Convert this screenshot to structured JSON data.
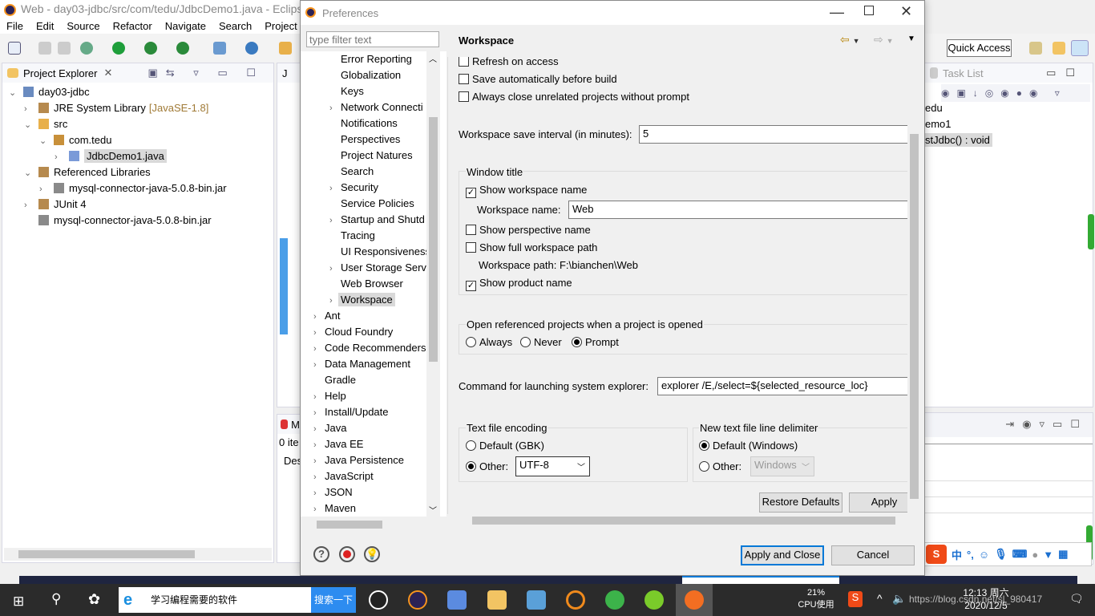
{
  "eclipse": {
    "window_title": "Web - day03-jdbc/src/com/tedu/JdbcDemo1.java - Eclipse P",
    "menu": [
      "File",
      "Edit",
      "Source",
      "Refactor",
      "Navigate",
      "Search",
      "Project",
      "R"
    ],
    "quick_access": "Quick Access",
    "project_explorer": {
      "tab_label": "Project Explorer",
      "tree": [
        {
          "label": "day03-jdbc",
          "depth": 0,
          "expanded": true,
          "icon": "project-icon"
        },
        {
          "label": "JRE System Library",
          "suffix": "[JavaSE-1.8]",
          "depth": 1,
          "expanded": false,
          "icon": "library-icon"
        },
        {
          "label": "src",
          "depth": 1,
          "expanded": true,
          "icon": "source-folder-icon"
        },
        {
          "label": "com.tedu",
          "depth": 2,
          "expanded": true,
          "icon": "package-icon"
        },
        {
          "label": "JdbcDemo1.java",
          "depth": 3,
          "expanded": false,
          "icon": "java-file-icon",
          "selected": true
        },
        {
          "label": "Referenced Libraries",
          "depth": 1,
          "expanded": true,
          "icon": "library-icon"
        },
        {
          "label": "mysql-connector-java-5.0.8-bin.jar",
          "depth": 2,
          "expanded": false,
          "icon": "jar-icon"
        },
        {
          "label": "JUnit 4",
          "depth": 1,
          "expanded": false,
          "icon": "library-icon"
        },
        {
          "label": "mysql-connector-java-5.0.8-bin.jar",
          "depth": 1,
          "icon": "jar-icon",
          "leaf": true
        }
      ]
    },
    "editor_tab": "J",
    "outline": {
      "tab_label": "Task List",
      "items": [
        "edu",
        "emo1",
        "stJdbc() : void"
      ]
    },
    "problems": {
      "tab_label": "M",
      "count": "0 ite",
      "column": "Des"
    }
  },
  "dialog": {
    "title": "Preferences",
    "filter_placeholder": "type filter text",
    "tree": [
      {
        "label": "Error Reporting",
        "depth": 1
      },
      {
        "label": "Globalization",
        "depth": 1
      },
      {
        "label": "Keys",
        "depth": 1
      },
      {
        "label": "Network Connecti",
        "depth": 1,
        "expandable": true
      },
      {
        "label": "Notifications",
        "depth": 1
      },
      {
        "label": "Perspectives",
        "depth": 1
      },
      {
        "label": "Project Natures",
        "depth": 1
      },
      {
        "label": "Search",
        "depth": 1
      },
      {
        "label": "Security",
        "depth": 1,
        "expandable": true
      },
      {
        "label": "Service Policies",
        "depth": 1
      },
      {
        "label": "Startup and Shutd",
        "depth": 1,
        "expandable": true
      },
      {
        "label": "Tracing",
        "depth": 1
      },
      {
        "label": "UI Responsiveness",
        "depth": 1
      },
      {
        "label": "User Storage Serv",
        "depth": 1,
        "expandable": true
      },
      {
        "label": "Web Browser",
        "depth": 1
      },
      {
        "label": "Workspace",
        "depth": 1,
        "expandable": true,
        "selected": true
      },
      {
        "label": "Ant",
        "depth": 0,
        "expandable": true
      },
      {
        "label": "Cloud Foundry",
        "depth": 0,
        "expandable": true
      },
      {
        "label": "Code Recommenders",
        "depth": 0,
        "expandable": true
      },
      {
        "label": "Data Management",
        "depth": 0,
        "expandable": true
      },
      {
        "label": "Gradle",
        "depth": 0
      },
      {
        "label": "Help",
        "depth": 0,
        "expandable": true
      },
      {
        "label": "Install/Update",
        "depth": 0,
        "expandable": true
      },
      {
        "label": "Java",
        "depth": 0,
        "expandable": true
      },
      {
        "label": "Java EE",
        "depth": 0,
        "expandable": true
      },
      {
        "label": "Java Persistence",
        "depth": 0,
        "expandable": true
      },
      {
        "label": "JavaScript",
        "depth": 0,
        "expandable": true
      },
      {
        "label": "JSON",
        "depth": 0,
        "expandable": true
      },
      {
        "label": "Maven",
        "depth": 0,
        "expandable": true
      }
    ],
    "page": {
      "title": "Workspace",
      "refresh_on_access": {
        "label": "Refresh on access",
        "checked": false
      },
      "save_before_build": {
        "label": "Save automatically before build",
        "checked": false
      },
      "close_unrelated": {
        "label": "Always close unrelated projects without prompt",
        "checked": false
      },
      "save_interval_label": "Workspace save interval (in minutes):",
      "save_interval": "5",
      "window_title_group": "Window title",
      "show_workspace_name": {
        "label": "Show workspace name",
        "checked": true
      },
      "workspace_name_label": "Workspace name:",
      "workspace_name": "Web",
      "show_perspective_name": {
        "label": "Show perspective name",
        "checked": false
      },
      "show_full_path": {
        "label": "Show full workspace path",
        "checked": false
      },
      "workspace_path_label": "Workspace path:",
      "workspace_path": "F:\\bianchen\\Web",
      "show_product_name": {
        "label": "Show product name",
        "checked": true
      },
      "open_ref_group": "Open referenced projects when a project is opened",
      "open_ref_options": [
        "Always",
        "Never",
        "Prompt"
      ],
      "open_ref_selected": "Prompt",
      "explorer_cmd_label": "Command for launching system explorer:",
      "explorer_cmd": "explorer /E,/select=${selected_resource_loc}",
      "encoding_group": "Text file encoding",
      "encoding_default": "Default (GBK)",
      "encoding_other": "Other:",
      "encoding_selected": "Other",
      "encoding_value": "UTF-8",
      "delimiter_group": "New text file line delimiter",
      "delimiter_default": "Default (Windows)",
      "delimiter_other": "Other:",
      "delimiter_selected": "Default",
      "delimiter_value": "Windows",
      "restore_defaults": "Restore Defaults",
      "apply": "Apply"
    },
    "apply_and_close": "Apply and Close",
    "cancel": "Cancel"
  },
  "taskbar": {
    "search_text": "学习编程需要的软件",
    "search_button": "搜索一下",
    "cpu_percent": "21%",
    "cpu_label": "CPU使用",
    "time": "12:13 周六",
    "date": "2020/12/5",
    "watermark": "https://blog.csdn.net/sl_980417"
  },
  "ime": {
    "mode": "中",
    "punct": "°,"
  },
  "colors": {
    "accent": "#0078d7",
    "selection": "#cce8ff",
    "taskbar": "#2b2b2b"
  }
}
